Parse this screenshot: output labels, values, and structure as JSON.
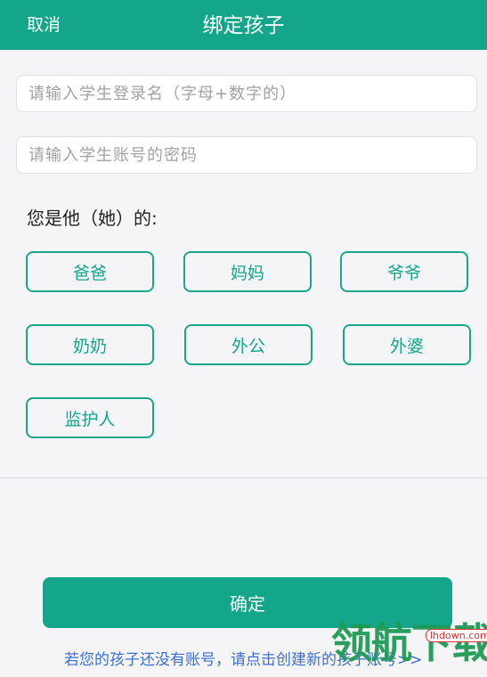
{
  "header": {
    "cancel_label": "取消",
    "title": "绑定孩子",
    "background_color": "#13a68a"
  },
  "form": {
    "username_placeholder": "请输入学生登录名（字母+数字的）",
    "password_placeholder": "请输入学生账号的密码"
  },
  "relation": {
    "question": "您是他（她）的:",
    "options": [
      "爸爸",
      "妈妈",
      "爷爷",
      "奶奶",
      "外公",
      "外婆",
      "监护人"
    ]
  },
  "footer": {
    "confirm_label": "确定",
    "hint": "若您的孩子还没有账号，请点击创建新的孩子账号>>"
  },
  "watermark": {
    "text": "领航下载",
    "site": "lhdown.com"
  }
}
